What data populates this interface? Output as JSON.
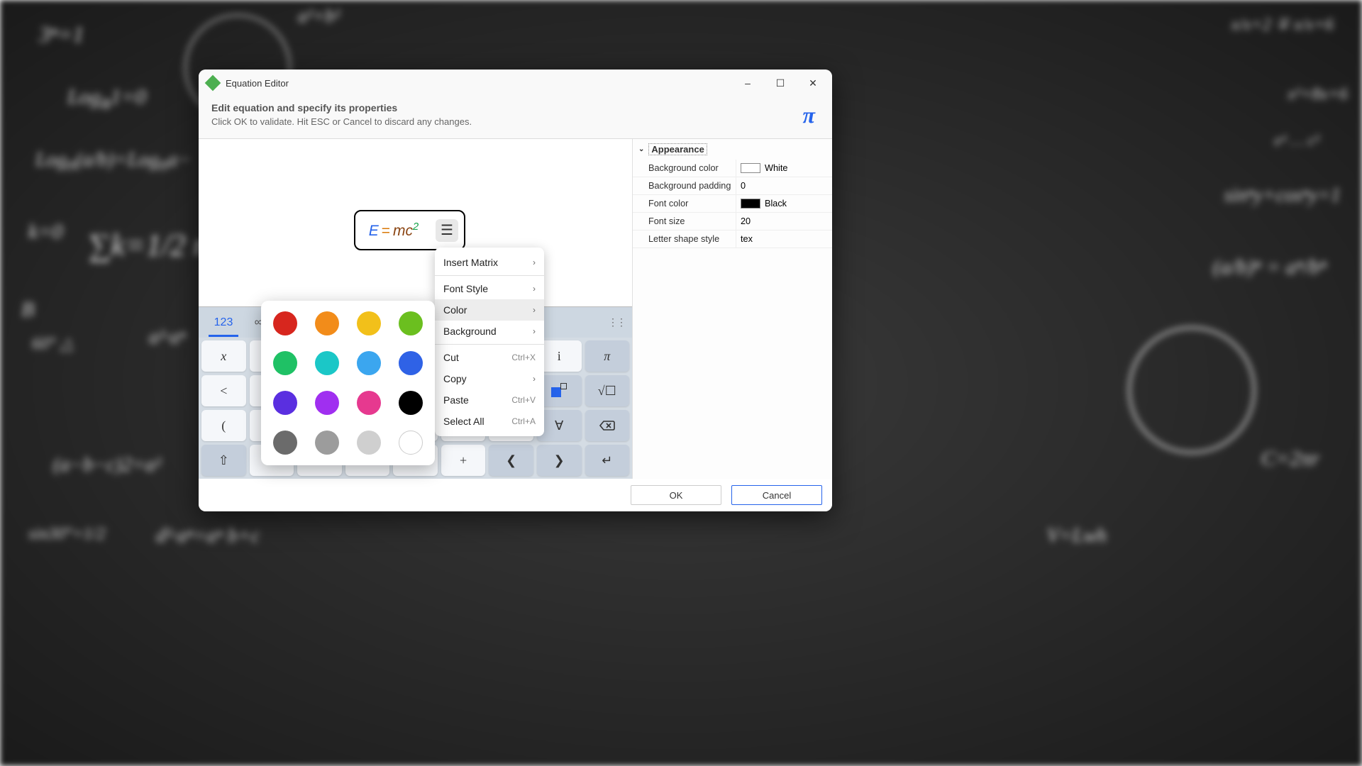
{
  "window": {
    "title": "Equation Editor",
    "minimize": "–",
    "maximize": "☐",
    "close": "✕"
  },
  "header": {
    "title": "Edit equation and specify its properties",
    "subtitle": "Click OK to validate. Hit ESC or Cancel to discard any changes.",
    "pi": "π"
  },
  "equation": {
    "E": "E",
    "eq": "=",
    "m": "m",
    "c": "c",
    "sup": "2"
  },
  "keypad": {
    "tabs": {
      "t0": "123",
      "t1": "∞β∂"
    },
    "handle": "⋮⋮",
    "row0": {
      "k0": "x",
      "k7": "i",
      "k8": "π"
    },
    "row1": {
      "k0": "<",
      "k8": "√☐"
    },
    "row2": {
      "k0": "(",
      "k7": "∀"
    },
    "row3": {
      "k0": "⇧",
      "k5": "+",
      "k6": "❮",
      "k7": "❯",
      "k8": "↵"
    }
  },
  "props": {
    "section": "Appearance",
    "r0": {
      "label": "Background color",
      "value": "White"
    },
    "r1": {
      "label": "Background padding",
      "value": "0"
    },
    "r2": {
      "label": "Font color",
      "value": "Black"
    },
    "r3": {
      "label": "Font size",
      "value": "20"
    },
    "r4": {
      "label": "Letter shape style",
      "value": "tex"
    }
  },
  "footer": {
    "ok": "OK",
    "cancel": "Cancel"
  },
  "menu": {
    "insert_matrix": "Insert Matrix",
    "font_style": "Font Style",
    "color": "Color",
    "background": "Background",
    "cut": "Cut",
    "cut_s": "Ctrl+X",
    "copy": "Copy",
    "paste": "Paste",
    "paste_s": "Ctrl+V",
    "select_all": "Select All",
    "select_all_s": "Ctrl+A"
  },
  "colors": [
    "#d7261e",
    "#f28c1a",
    "#f2c01a",
    "#6bbf1f",
    "#1fc165",
    "#1bc7c7",
    "#3ba6ef",
    "#2f62e6",
    "#5a2fe0",
    "#a02ff0",
    "#e6398f",
    "#000000",
    "#6b6b6b",
    "#9c9c9c",
    "#cfcfcf",
    "#ffffff"
  ]
}
